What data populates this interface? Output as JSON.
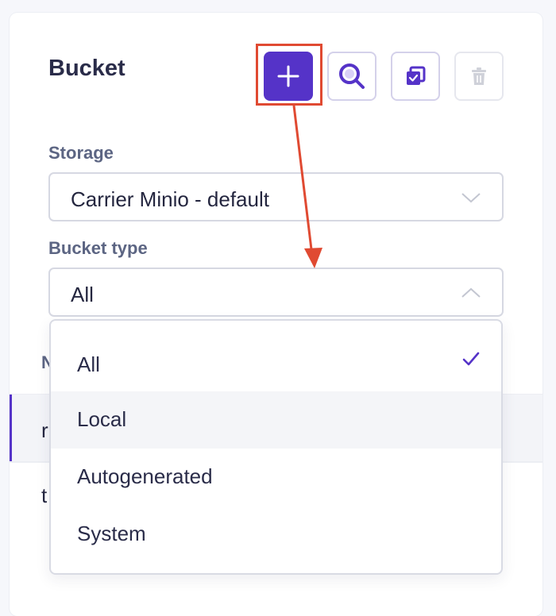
{
  "panel": {
    "title": "Bucket"
  },
  "toolbar": {
    "add_icon": "plus-icon",
    "search_icon": "search-icon",
    "copy_icon": "copy-check-icon",
    "delete_icon": "trash-icon"
  },
  "storage": {
    "label": "Storage",
    "value": "Carrier Minio - default"
  },
  "bucket_type": {
    "label": "Bucket type",
    "value": "All",
    "options": [
      "All",
      "Local",
      "Autogenerated",
      "System"
    ],
    "selected": "All"
  },
  "table_behind": {
    "header_partial": "N",
    "rows_partial": [
      "r",
      "t"
    ]
  },
  "colors": {
    "accent": "#5533c8",
    "annotation": "#e04a32"
  }
}
